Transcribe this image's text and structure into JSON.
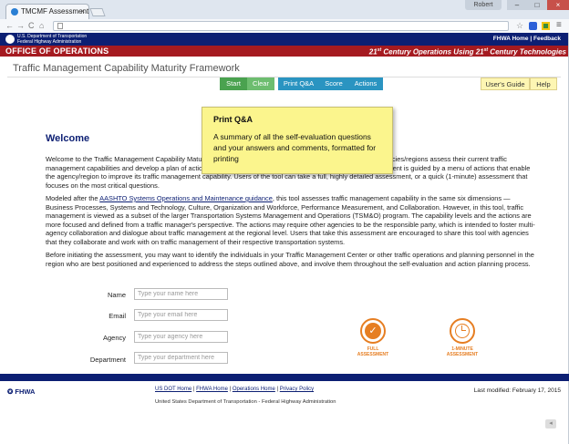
{
  "browser": {
    "tab_title": "TMCMF Assessment",
    "tab_close": "×",
    "user": "Robert",
    "min": "–",
    "max": "□",
    "close": "×",
    "back": "←",
    "forward": "→",
    "reload": "C",
    "home": "⌂",
    "star": "☆",
    "menu": "≡"
  },
  "header": {
    "dot_line1": "U.S. Department of Transportation",
    "dot_line2": "Federal Highway Administration",
    "fhwa_home": "FHWA Home",
    "sep": "|",
    "feedback": "Feedback",
    "office": "OFFICE OF OPERATIONS",
    "ops_21a": "21",
    "ops_sup_a": "st",
    "ops_mid": " Century Operations Using 21",
    "ops_sup_b": "st",
    "ops_end": " Century Technologies"
  },
  "app": {
    "title": "Traffic Management Capability Maturity Framework"
  },
  "toolbar": {
    "start": "Start",
    "clear": "Clear",
    "print": "Print Q&A",
    "score": "Score",
    "actions": "Actions",
    "guide": "User's Guide",
    "help": "Help"
  },
  "tooltip": {
    "title": "Print Q&A",
    "body": "A summary of all the self-evaluation questions and your answers and comments, formatted for printing"
  },
  "main": {
    "heading": "Welcome",
    "p1": "Welcome to the Traffic Management Capability Maturity Framework (TMCMF). This tool was developed to help agencies/regions assess their current traffic management capabilities and develop a plan of actions to advance to the next level of capability. This plan development is guided by a menu of actions that enable the agency/region to improve its traffic management capability. Users of the tool can take a full, highly detailed assessment, or a quick (1-minute) assessment that focuses on the most critical questions.",
    "p2_pre": "Modeled after the ",
    "p2_link": "AASHTO Systems Operations and Maintenance guidance",
    "p2_post": ", this tool assesses traffic management capability in the same six dimensions — Business Processes, Systems and Technology, Culture, Organization and Workforce, Performance Measurement, and Collaboration. However, in this tool, traffic management is viewed as a subset of the larger Transportation Systems Management and Operations (TSM&O) program. The capability levels and the actions are more focused and defined from a traffic manager's perspective. The actions may require other agencies to be the responsible party, which is intended to foster multi-agency collaboration and dialogue about traffic management at the regional level. Users that take this assessment are encouraged to share this tool with agencies that they collaborate and work with on traffic management of their respective transportation systems.",
    "p3": "Before initiating the assessment, you may want to identify the individuals in your Traffic Management Center or other traffic operations and planning personnel in the region who are best positioned and experienced to address the steps outlined above, and involve them throughout the self-evaluation and action planning process."
  },
  "form": {
    "name_label": "Name",
    "name_ph": "Type your name here",
    "email_label": "Email",
    "email_ph": "Type your email here",
    "agency_label": "Agency",
    "agency_ph": "Type your agency here",
    "dept_label": "Department",
    "dept_ph": "Type your department here"
  },
  "assessments": {
    "full_line1": "FULL",
    "full_line2": "ASSESSMENT",
    "quick_line1": "1-MINUTE",
    "quick_line2": "ASSESSMENT"
  },
  "footer": {
    "logo": "FHWA",
    "dot_home": "US DOT Home",
    "fhwa_home": "FHWA Home",
    "ops_home": "Operations Home",
    "privacy": "Privacy Policy",
    "sep": " | ",
    "dot_line": "United States Department of Transportation - Federal Highway Administration",
    "last_modified": "Last modified: February 17, 2015"
  },
  "colors": {
    "dot_blue": "#0c1f73",
    "ops_red": "#a51a20",
    "green": "#4aa24f",
    "teal": "#2a94c1",
    "tooltip_yellow": "#fbf58d",
    "orange": "#e67e22"
  }
}
